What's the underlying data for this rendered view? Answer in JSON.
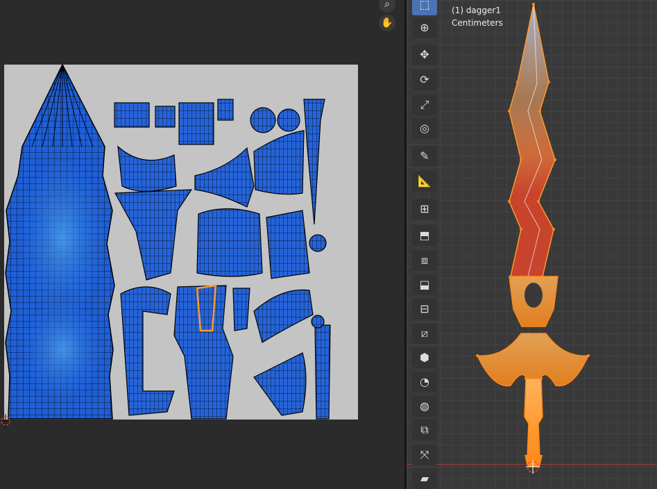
{
  "uv_editor": {
    "nav": [
      {
        "name": "zoom-icon",
        "glyph": "⌕"
      },
      {
        "name": "pan-hand-icon",
        "glyph": "✋"
      }
    ]
  },
  "viewport": {
    "object_label": "(1) dagger1",
    "units_label": "Centimeters"
  },
  "toolbar": {
    "tools": [
      {
        "name": "select-box-tool",
        "glyph": "⬚",
        "active": true
      },
      {
        "name": "cursor-tool",
        "glyph": "⊕"
      },
      {
        "name": "move-tool",
        "glyph": "✥"
      },
      {
        "name": "rotate-tool",
        "glyph": "⟳"
      },
      {
        "name": "scale-tool",
        "glyph": "⤢"
      },
      {
        "name": "transform-tool",
        "glyph": "◎"
      },
      {
        "name": "annotate-tool",
        "glyph": "✎"
      },
      {
        "name": "measure-tool",
        "glyph": "📐"
      },
      {
        "name": "add-cube-tool",
        "glyph": "⊞"
      },
      {
        "name": "extrude-region-tool",
        "glyph": "⬒"
      },
      {
        "name": "inset-faces-tool",
        "glyph": "⧈"
      },
      {
        "name": "bevel-tool",
        "glyph": "⬓"
      },
      {
        "name": "loop-cut-tool",
        "glyph": "⊟"
      },
      {
        "name": "knife-tool",
        "glyph": "⧄"
      },
      {
        "name": "poly-build-tool",
        "glyph": "⬢"
      },
      {
        "name": "spin-tool",
        "glyph": "◔"
      },
      {
        "name": "smooth-tool",
        "glyph": "◍"
      },
      {
        "name": "edge-slide-tool",
        "glyph": "⧉"
      },
      {
        "name": "shrink-fatten-tool",
        "glyph": "⤧"
      },
      {
        "name": "shear-tool",
        "glyph": "▰"
      }
    ]
  },
  "colors": {
    "uv_face": "#1f5fd6",
    "uv_face_light": "#3d8ee8",
    "uv_edge": "#000000",
    "uv_canvas": "#c4c4c4",
    "blade_glow": "#ff8a1a",
    "blade_core": "#e85a2a",
    "selection_orange": "#ff9a2e",
    "active_tool": "#4a73b5"
  }
}
